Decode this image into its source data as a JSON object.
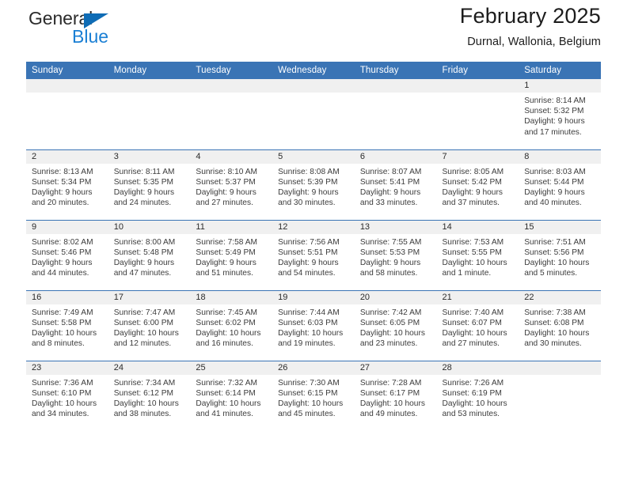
{
  "logo": {
    "text_top": "General",
    "text_bottom": "Blue",
    "triangle_color": "#0f6cb5",
    "blue_color": "#1a7fd4"
  },
  "header": {
    "title": "February 2025",
    "subtitle": "Durnal, Wallonia, Belgium"
  },
  "theme": {
    "header_blue": "#3a74b5",
    "daynum_band": "#f0f0f0",
    "text": "#3c3c3c"
  },
  "calendar": {
    "weekday_headers": [
      "Sunday",
      "Monday",
      "Tuesday",
      "Wednesday",
      "Thursday",
      "Friday",
      "Saturday"
    ],
    "weeks": [
      [
        {
          "day": "",
          "lines": []
        },
        {
          "day": "",
          "lines": []
        },
        {
          "day": "",
          "lines": []
        },
        {
          "day": "",
          "lines": []
        },
        {
          "day": "",
          "lines": []
        },
        {
          "day": "",
          "lines": []
        },
        {
          "day": "1",
          "lines": [
            "Sunrise: 8:14 AM",
            "Sunset: 5:32 PM",
            "Daylight: 9 hours",
            "and 17 minutes."
          ]
        }
      ],
      [
        {
          "day": "2",
          "lines": [
            "Sunrise: 8:13 AM",
            "Sunset: 5:34 PM",
            "Daylight: 9 hours",
            "and 20 minutes."
          ]
        },
        {
          "day": "3",
          "lines": [
            "Sunrise: 8:11 AM",
            "Sunset: 5:35 PM",
            "Daylight: 9 hours",
            "and 24 minutes."
          ]
        },
        {
          "day": "4",
          "lines": [
            "Sunrise: 8:10 AM",
            "Sunset: 5:37 PM",
            "Daylight: 9 hours",
            "and 27 minutes."
          ]
        },
        {
          "day": "5",
          "lines": [
            "Sunrise: 8:08 AM",
            "Sunset: 5:39 PM",
            "Daylight: 9 hours",
            "and 30 minutes."
          ]
        },
        {
          "day": "6",
          "lines": [
            "Sunrise: 8:07 AM",
            "Sunset: 5:41 PM",
            "Daylight: 9 hours",
            "and 33 minutes."
          ]
        },
        {
          "day": "7",
          "lines": [
            "Sunrise: 8:05 AM",
            "Sunset: 5:42 PM",
            "Daylight: 9 hours",
            "and 37 minutes."
          ]
        },
        {
          "day": "8",
          "lines": [
            "Sunrise: 8:03 AM",
            "Sunset: 5:44 PM",
            "Daylight: 9 hours",
            "and 40 minutes."
          ]
        }
      ],
      [
        {
          "day": "9",
          "lines": [
            "Sunrise: 8:02 AM",
            "Sunset: 5:46 PM",
            "Daylight: 9 hours",
            "and 44 minutes."
          ]
        },
        {
          "day": "10",
          "lines": [
            "Sunrise: 8:00 AM",
            "Sunset: 5:48 PM",
            "Daylight: 9 hours",
            "and 47 minutes."
          ]
        },
        {
          "day": "11",
          "lines": [
            "Sunrise: 7:58 AM",
            "Sunset: 5:49 PM",
            "Daylight: 9 hours",
            "and 51 minutes."
          ]
        },
        {
          "day": "12",
          "lines": [
            "Sunrise: 7:56 AM",
            "Sunset: 5:51 PM",
            "Daylight: 9 hours",
            "and 54 minutes."
          ]
        },
        {
          "day": "13",
          "lines": [
            "Sunrise: 7:55 AM",
            "Sunset: 5:53 PM",
            "Daylight: 9 hours",
            "and 58 minutes."
          ]
        },
        {
          "day": "14",
          "lines": [
            "Sunrise: 7:53 AM",
            "Sunset: 5:55 PM",
            "Daylight: 10 hours",
            "and 1 minute."
          ]
        },
        {
          "day": "15",
          "lines": [
            "Sunrise: 7:51 AM",
            "Sunset: 5:56 PM",
            "Daylight: 10 hours",
            "and 5 minutes."
          ]
        }
      ],
      [
        {
          "day": "16",
          "lines": [
            "Sunrise: 7:49 AM",
            "Sunset: 5:58 PM",
            "Daylight: 10 hours",
            "and 8 minutes."
          ]
        },
        {
          "day": "17",
          "lines": [
            "Sunrise: 7:47 AM",
            "Sunset: 6:00 PM",
            "Daylight: 10 hours",
            "and 12 minutes."
          ]
        },
        {
          "day": "18",
          "lines": [
            "Sunrise: 7:45 AM",
            "Sunset: 6:02 PM",
            "Daylight: 10 hours",
            "and 16 minutes."
          ]
        },
        {
          "day": "19",
          "lines": [
            "Sunrise: 7:44 AM",
            "Sunset: 6:03 PM",
            "Daylight: 10 hours",
            "and 19 minutes."
          ]
        },
        {
          "day": "20",
          "lines": [
            "Sunrise: 7:42 AM",
            "Sunset: 6:05 PM",
            "Daylight: 10 hours",
            "and 23 minutes."
          ]
        },
        {
          "day": "21",
          "lines": [
            "Sunrise: 7:40 AM",
            "Sunset: 6:07 PM",
            "Daylight: 10 hours",
            "and 27 minutes."
          ]
        },
        {
          "day": "22",
          "lines": [
            "Sunrise: 7:38 AM",
            "Sunset: 6:08 PM",
            "Daylight: 10 hours",
            "and 30 minutes."
          ]
        }
      ],
      [
        {
          "day": "23",
          "lines": [
            "Sunrise: 7:36 AM",
            "Sunset: 6:10 PM",
            "Daylight: 10 hours",
            "and 34 minutes."
          ]
        },
        {
          "day": "24",
          "lines": [
            "Sunrise: 7:34 AM",
            "Sunset: 6:12 PM",
            "Daylight: 10 hours",
            "and 38 minutes."
          ]
        },
        {
          "day": "25",
          "lines": [
            "Sunrise: 7:32 AM",
            "Sunset: 6:14 PM",
            "Daylight: 10 hours",
            "and 41 minutes."
          ]
        },
        {
          "day": "26",
          "lines": [
            "Sunrise: 7:30 AM",
            "Sunset: 6:15 PM",
            "Daylight: 10 hours",
            "and 45 minutes."
          ]
        },
        {
          "day": "27",
          "lines": [
            "Sunrise: 7:28 AM",
            "Sunset: 6:17 PM",
            "Daylight: 10 hours",
            "and 49 minutes."
          ]
        },
        {
          "day": "28",
          "lines": [
            "Sunrise: 7:26 AM",
            "Sunset: 6:19 PM",
            "Daylight: 10 hours",
            "and 53 minutes."
          ]
        },
        {
          "day": "",
          "lines": []
        }
      ]
    ]
  }
}
